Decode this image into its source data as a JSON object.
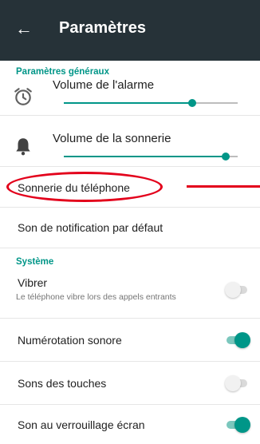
{
  "app_bar": {
    "back_icon": "arrow-left-icon",
    "title": "Paramètres"
  },
  "general": {
    "header": "Paramètres généraux",
    "alarm_volume": {
      "icon": "alarm-clock-icon",
      "label": "Volume de l'alarme",
      "level": 0.74
    },
    "ringer_volume": {
      "icon": "bell-icon",
      "label": "Volume de la sonnerie",
      "level": 0.93
    },
    "phone_ringtone": {
      "label": "Sonnerie du téléphone"
    },
    "default_notification": {
      "label": "Son de notification par défaut"
    }
  },
  "system": {
    "header": "Système",
    "vibrate": {
      "label": "Vibrer",
      "summary": "Le téléphone vibre lors des appels entrants",
      "checked": false
    },
    "dial_pad_tones": {
      "label": "Numérotation sonore",
      "checked": true
    },
    "touch_sounds": {
      "label": "Sons des touches",
      "checked": false
    },
    "screen_lock_sound": {
      "label": "Son au verrouillage écran",
      "checked": true
    }
  },
  "colors": {
    "accent": "#009688",
    "app_bar": "#263238",
    "annotation": "#e3001b"
  }
}
